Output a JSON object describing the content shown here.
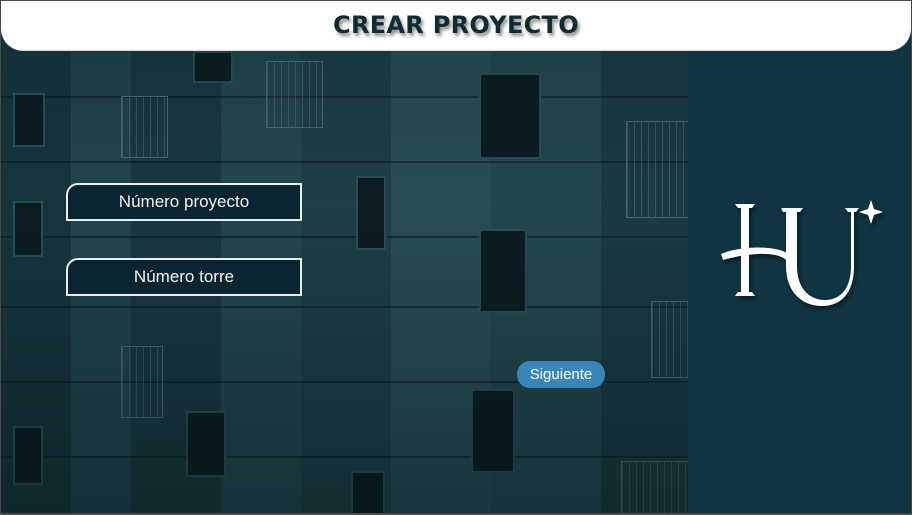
{
  "header": {
    "title": "CREAR PROYECTO"
  },
  "form": {
    "project_number_placeholder": "Número proyecto",
    "tower_number_placeholder": "Número torre",
    "next_label": "Siguiente"
  },
  "logo": {
    "name": "hu-logo-icon"
  },
  "colors": {
    "panel": "#0f3540",
    "header_bg": "#ffffff",
    "title": "#0f2b33",
    "field_bg": "#0b2530",
    "button": "#3a86b8"
  }
}
